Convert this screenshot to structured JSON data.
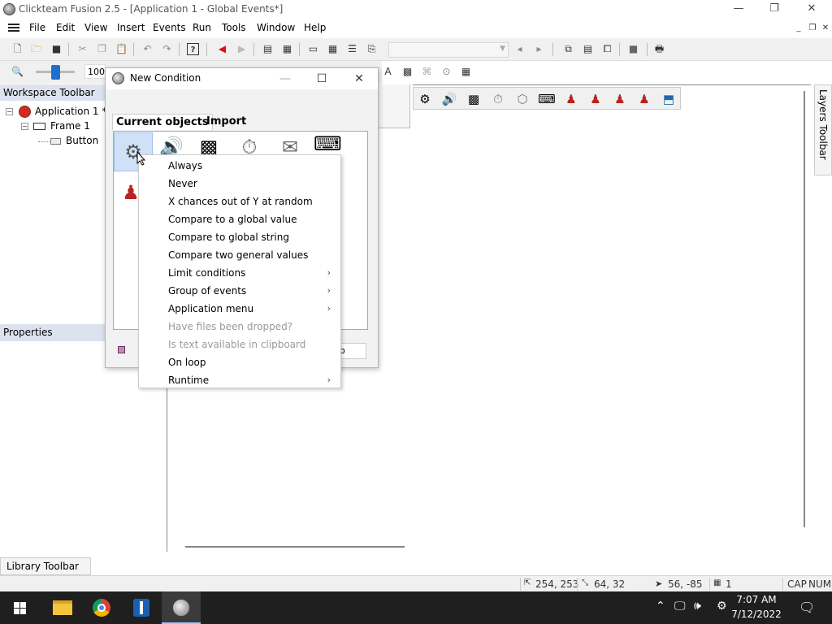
{
  "window": {
    "title": "Clickteam Fusion 2.5 - [Application 1 - Global Events*]",
    "controls": {
      "minimize": "—",
      "maximize": "❐",
      "close": "✕"
    }
  },
  "menubar": {
    "items": [
      "File",
      "Edit",
      "View",
      "Insert",
      "Events",
      "Run",
      "Tools",
      "Window",
      "Help"
    ],
    "mdi_controls": [
      "_",
      "❐",
      "✕"
    ]
  },
  "toolbar": {
    "zoom_value": "100"
  },
  "workspace": {
    "title": "Workspace Toolbar",
    "tree": {
      "application": "Application 1 *",
      "frame": "Frame 1",
      "object": "Button"
    }
  },
  "properties": {
    "title": "Properties"
  },
  "layers": {
    "label": "Layers Toolbar"
  },
  "library": {
    "label": "Library Toolbar"
  },
  "dialog": {
    "title": "New Condition",
    "tabs": [
      "Current objects",
      "Import"
    ],
    "bottom_button": "o"
  },
  "context_menu": {
    "items": [
      {
        "label": "Always",
        "disabled": false,
        "submenu": false
      },
      {
        "label": "Never",
        "disabled": false,
        "submenu": false
      },
      {
        "label": "X chances out of Y at random",
        "disabled": false,
        "submenu": false
      },
      {
        "label": "Compare to a global value",
        "disabled": false,
        "submenu": false
      },
      {
        "label": "Compare to global string",
        "disabled": false,
        "submenu": false
      },
      {
        "label": "Compare two general values",
        "disabled": false,
        "submenu": false
      },
      {
        "label": "Limit conditions",
        "disabled": false,
        "submenu": true
      },
      {
        "label": "Group of events",
        "disabled": false,
        "submenu": true
      },
      {
        "label": "Application menu",
        "disabled": false,
        "submenu": true
      },
      {
        "label": "Have files been dropped?",
        "disabled": true,
        "submenu": false
      },
      {
        "label": "Is text available in clipboard",
        "disabled": true,
        "submenu": false
      },
      {
        "label": "On loop",
        "disabled": false,
        "submenu": false
      },
      {
        "label": "Runtime",
        "disabled": false,
        "submenu": true
      }
    ],
    "submenu_arrow": "›"
  },
  "statusbar": {
    "position": "254, 253",
    "size": "64, 32",
    "mouse": "56, -85",
    "layer": "1",
    "caps": "CAP",
    "num": "NUM"
  },
  "taskbar": {
    "time": "7:07 AM",
    "date": "7/12/2022"
  },
  "colors": {
    "accent": "#1f6fd0",
    "workspace_header": "#dce3ee",
    "selection": "#cfe0f7",
    "taskbar": "#1f1f1f"
  }
}
